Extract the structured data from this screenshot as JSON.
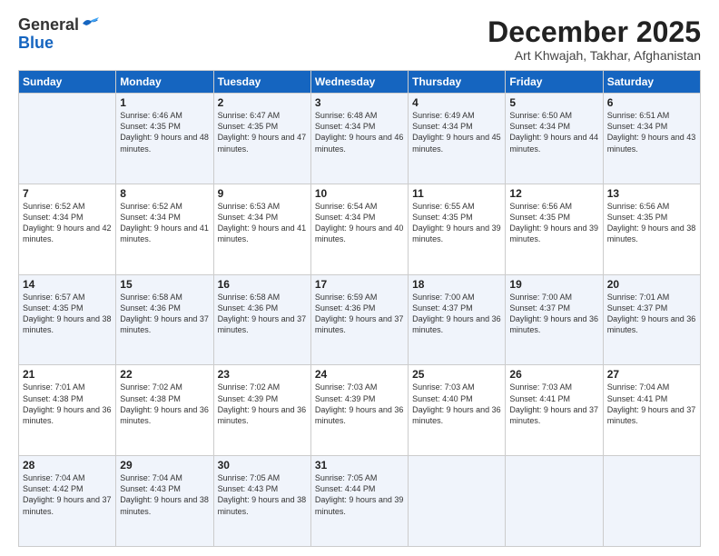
{
  "logo": {
    "general": "General",
    "blue": "Blue"
  },
  "header": {
    "month": "December 2025",
    "location": "Art Khwajah, Takhar, Afghanistan"
  },
  "weekdays": [
    "Sunday",
    "Monday",
    "Tuesday",
    "Wednesday",
    "Thursday",
    "Friday",
    "Saturday"
  ],
  "weeks": [
    [
      {
        "day": "",
        "sunrise": "",
        "sunset": "",
        "daylight": ""
      },
      {
        "day": "1",
        "sunrise": "Sunrise: 6:46 AM",
        "sunset": "Sunset: 4:35 PM",
        "daylight": "Daylight: 9 hours and 48 minutes."
      },
      {
        "day": "2",
        "sunrise": "Sunrise: 6:47 AM",
        "sunset": "Sunset: 4:35 PM",
        "daylight": "Daylight: 9 hours and 47 minutes."
      },
      {
        "day": "3",
        "sunrise": "Sunrise: 6:48 AM",
        "sunset": "Sunset: 4:34 PM",
        "daylight": "Daylight: 9 hours and 46 minutes."
      },
      {
        "day": "4",
        "sunrise": "Sunrise: 6:49 AM",
        "sunset": "Sunset: 4:34 PM",
        "daylight": "Daylight: 9 hours and 45 minutes."
      },
      {
        "day": "5",
        "sunrise": "Sunrise: 6:50 AM",
        "sunset": "Sunset: 4:34 PM",
        "daylight": "Daylight: 9 hours and 44 minutes."
      },
      {
        "day": "6",
        "sunrise": "Sunrise: 6:51 AM",
        "sunset": "Sunset: 4:34 PM",
        "daylight": "Daylight: 9 hours and 43 minutes."
      }
    ],
    [
      {
        "day": "7",
        "sunrise": "Sunrise: 6:52 AM",
        "sunset": "Sunset: 4:34 PM",
        "daylight": "Daylight: 9 hours and 42 minutes."
      },
      {
        "day": "8",
        "sunrise": "Sunrise: 6:52 AM",
        "sunset": "Sunset: 4:34 PM",
        "daylight": "Daylight: 9 hours and 41 minutes."
      },
      {
        "day": "9",
        "sunrise": "Sunrise: 6:53 AM",
        "sunset": "Sunset: 4:34 PM",
        "daylight": "Daylight: 9 hours and 41 minutes."
      },
      {
        "day": "10",
        "sunrise": "Sunrise: 6:54 AM",
        "sunset": "Sunset: 4:34 PM",
        "daylight": "Daylight: 9 hours and 40 minutes."
      },
      {
        "day": "11",
        "sunrise": "Sunrise: 6:55 AM",
        "sunset": "Sunset: 4:35 PM",
        "daylight": "Daylight: 9 hours and 39 minutes."
      },
      {
        "day": "12",
        "sunrise": "Sunrise: 6:56 AM",
        "sunset": "Sunset: 4:35 PM",
        "daylight": "Daylight: 9 hours and 39 minutes."
      },
      {
        "day": "13",
        "sunrise": "Sunrise: 6:56 AM",
        "sunset": "Sunset: 4:35 PM",
        "daylight": "Daylight: 9 hours and 38 minutes."
      }
    ],
    [
      {
        "day": "14",
        "sunrise": "Sunrise: 6:57 AM",
        "sunset": "Sunset: 4:35 PM",
        "daylight": "Daylight: 9 hours and 38 minutes."
      },
      {
        "day": "15",
        "sunrise": "Sunrise: 6:58 AM",
        "sunset": "Sunset: 4:36 PM",
        "daylight": "Daylight: 9 hours and 37 minutes."
      },
      {
        "day": "16",
        "sunrise": "Sunrise: 6:58 AM",
        "sunset": "Sunset: 4:36 PM",
        "daylight": "Daylight: 9 hours and 37 minutes."
      },
      {
        "day": "17",
        "sunrise": "Sunrise: 6:59 AM",
        "sunset": "Sunset: 4:36 PM",
        "daylight": "Daylight: 9 hours and 37 minutes."
      },
      {
        "day": "18",
        "sunrise": "Sunrise: 7:00 AM",
        "sunset": "Sunset: 4:37 PM",
        "daylight": "Daylight: 9 hours and 36 minutes."
      },
      {
        "day": "19",
        "sunrise": "Sunrise: 7:00 AM",
        "sunset": "Sunset: 4:37 PM",
        "daylight": "Daylight: 9 hours and 36 minutes."
      },
      {
        "day": "20",
        "sunrise": "Sunrise: 7:01 AM",
        "sunset": "Sunset: 4:37 PM",
        "daylight": "Daylight: 9 hours and 36 minutes."
      }
    ],
    [
      {
        "day": "21",
        "sunrise": "Sunrise: 7:01 AM",
        "sunset": "Sunset: 4:38 PM",
        "daylight": "Daylight: 9 hours and 36 minutes."
      },
      {
        "day": "22",
        "sunrise": "Sunrise: 7:02 AM",
        "sunset": "Sunset: 4:38 PM",
        "daylight": "Daylight: 9 hours and 36 minutes."
      },
      {
        "day": "23",
        "sunrise": "Sunrise: 7:02 AM",
        "sunset": "Sunset: 4:39 PM",
        "daylight": "Daylight: 9 hours and 36 minutes."
      },
      {
        "day": "24",
        "sunrise": "Sunrise: 7:03 AM",
        "sunset": "Sunset: 4:39 PM",
        "daylight": "Daylight: 9 hours and 36 minutes."
      },
      {
        "day": "25",
        "sunrise": "Sunrise: 7:03 AM",
        "sunset": "Sunset: 4:40 PM",
        "daylight": "Daylight: 9 hours and 36 minutes."
      },
      {
        "day": "26",
        "sunrise": "Sunrise: 7:03 AM",
        "sunset": "Sunset: 4:41 PM",
        "daylight": "Daylight: 9 hours and 37 minutes."
      },
      {
        "day": "27",
        "sunrise": "Sunrise: 7:04 AM",
        "sunset": "Sunset: 4:41 PM",
        "daylight": "Daylight: 9 hours and 37 minutes."
      }
    ],
    [
      {
        "day": "28",
        "sunrise": "Sunrise: 7:04 AM",
        "sunset": "Sunset: 4:42 PM",
        "daylight": "Daylight: 9 hours and 37 minutes."
      },
      {
        "day": "29",
        "sunrise": "Sunrise: 7:04 AM",
        "sunset": "Sunset: 4:43 PM",
        "daylight": "Daylight: 9 hours and 38 minutes."
      },
      {
        "day": "30",
        "sunrise": "Sunrise: 7:05 AM",
        "sunset": "Sunset: 4:43 PM",
        "daylight": "Daylight: 9 hours and 38 minutes."
      },
      {
        "day": "31",
        "sunrise": "Sunrise: 7:05 AM",
        "sunset": "Sunset: 4:44 PM",
        "daylight": "Daylight: 9 hours and 39 minutes."
      },
      {
        "day": "",
        "sunrise": "",
        "sunset": "",
        "daylight": ""
      },
      {
        "day": "",
        "sunrise": "",
        "sunset": "",
        "daylight": ""
      },
      {
        "day": "",
        "sunrise": "",
        "sunset": "",
        "daylight": ""
      }
    ]
  ]
}
